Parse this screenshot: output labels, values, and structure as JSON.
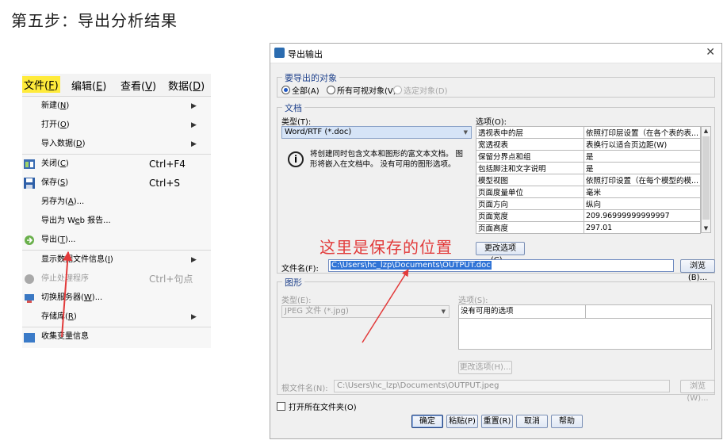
{
  "heading": "第五步：导出分析结果",
  "menu": {
    "bar": [
      {
        "label": "文件(",
        "key": "F",
        "end": ")",
        "active": true
      },
      {
        "label": "编辑(",
        "key": "E",
        "end": ")",
        "active": false
      },
      {
        "label": "查看(",
        "key": "V",
        "end": ")",
        "active": false
      },
      {
        "label": "数据(",
        "key": "D",
        "end": ")",
        "active": false
      }
    ],
    "items": {
      "new": {
        "label": "新建(",
        "key": "N",
        "end": ")"
      },
      "open": {
        "label": "打开(",
        "key": "O",
        "end": ")"
      },
      "import": {
        "label": "导入数据(",
        "key": "D",
        "end": ")"
      },
      "close": {
        "label": "关闭(",
        "key": "C",
        "end": ")",
        "shortcut": "Ctrl+F4"
      },
      "save": {
        "label": "保存(",
        "key": "S",
        "end": ")",
        "shortcut": "Ctrl+S"
      },
      "save_as": {
        "label": "另存为(",
        "key": "A",
        "end": ")..."
      },
      "export_web": {
        "label": "导出为 W",
        "key": "e",
        "end": "b 报告..."
      },
      "export": {
        "label": "导出(",
        "key": "T",
        "end": ")..."
      },
      "show_info": {
        "label": "显示数据文件信息(",
        "key": "I",
        "end": ")"
      },
      "stop": {
        "label": "停止处理程序",
        "shortcut": "Ctrl+句点"
      },
      "switch_server": {
        "label": "切换服务器(",
        "key": "W",
        "end": ")..."
      },
      "repository": {
        "label": "存储库(",
        "key": "R",
        "end": ")"
      },
      "partial": {
        "label": "收集变量信息"
      }
    }
  },
  "dialog": {
    "title": "导出输出",
    "objects_group": "要导出的对象",
    "radio_all": "全部(A)",
    "radio_visible": "所有可视对象(V)",
    "radio_selected": "选定对象(D)",
    "document_group": "文档",
    "type_label": "类型(T):",
    "type_value": "Word/RTF (*.doc)",
    "options_label": "选项(O):",
    "info_text": "将创建同时包含文本和图形的富文本文档。 图形将嵌入在文档中。 没有可用的图形选项。",
    "options_rows": [
      [
        "透视表中的层",
        "依照打印层设置（在各个表的表..."
      ],
      [
        "宽透视表",
        "表换行以适合页边距(W)"
      ],
      [
        "保留分界点和组",
        "是"
      ],
      [
        "包括脚注和文字说明",
        "是"
      ],
      [
        "模型视图",
        "依照打印设置（在每个模型的模..."
      ],
      [
        "页面度量单位",
        "毫米"
      ],
      [
        "页面方向",
        "纵向"
      ],
      [
        "页面宽度",
        "209.96999999999997"
      ],
      [
        "页面高度",
        "297.01"
      ]
    ],
    "change_options": "更改选项(C)...",
    "filename_label": "文件名(F):",
    "filename_value": "C:\\Users\\hc_lzp\\Documents\\OUTPUT.doc",
    "browse": "浏览(B)...",
    "graphics_group": "图形",
    "g_type_label": "类型(E):",
    "g_type_value": "JPEG 文件 (*.jpg)",
    "g_options_label": "选项(S):",
    "g_no_options": "没有可用的选项",
    "g_change_options": "更改选项(H)...",
    "root_label": "根文件名(N):",
    "root_value": "C:\\Users\\hc_lzp\\Documents\\OUTPUT.jpeg",
    "g_browse": "浏览(W)...",
    "open_folder": "打开所在文件夹(O)",
    "buttons": {
      "ok": "确定",
      "paste": "粘贴(P)",
      "reset": "重置(R)",
      "cancel": "取消",
      "help": "帮助"
    }
  },
  "annotation": "这里是保存的位置",
  "colors": {
    "highlight": "#ffeb3b",
    "annotation": "#e23a3a",
    "selection": "#2f73d6"
  }
}
